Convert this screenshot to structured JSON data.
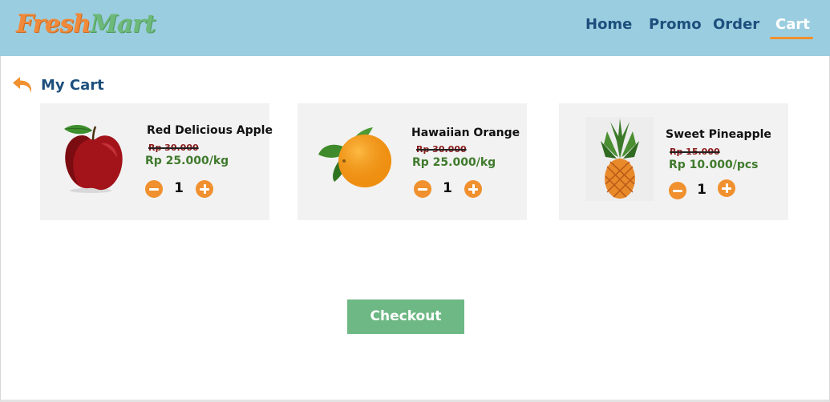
{
  "brand": {
    "part1": "Fresh",
    "part2": "Mart"
  },
  "nav": {
    "home": "Home",
    "promo": "Promo",
    "order": "Order",
    "cart": "Cart"
  },
  "page": {
    "title": "My Cart"
  },
  "cart": {
    "items": [
      {
        "name": "Red Delicious Apple",
        "old_price": "Rp 30.000",
        "price": "Rp 25.000/kg",
        "qty": "1"
      },
      {
        "name": "Hawaiian Orange",
        "old_price": "Rp 30.000",
        "price": "Rp 25.000/kg",
        "qty": "1"
      },
      {
        "name": "Sweet Pineapple",
        "old_price": "Rp 15.000",
        "price": "Rp 10.000/pcs",
        "qty": "1"
      }
    ]
  },
  "checkout": {
    "label": "Checkout"
  },
  "colors": {
    "navbar_bg": "#9bcde0",
    "accent_orange": "#f0902e",
    "nav_text": "#1d4f7d",
    "price_green": "#3f7a2c",
    "checkout_green": "#6db884"
  }
}
